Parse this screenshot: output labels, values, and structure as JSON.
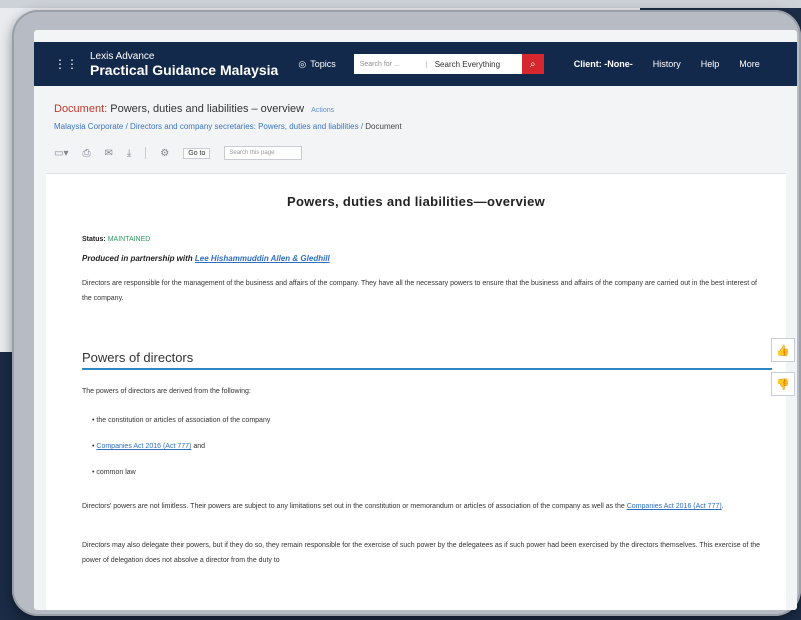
{
  "header": {
    "logo_top": "Lexis Advance",
    "logo_main": "Practical Guidance Malaysia",
    "topics": "Topics",
    "search_placeholder": "Search for ...",
    "search_scope": "Search Everything",
    "nav": [
      "Client: -None-",
      "History",
      "Help",
      "More"
    ]
  },
  "document": {
    "label": "Document:",
    "title": "Powers, duties and liabilities – overview",
    "actions": "Actions",
    "breadcrumb": [
      "Malaysia Corporate",
      "Directors and company secretaries: Powers, duties and liabilities"
    ],
    "breadcrumb_current": "Document"
  },
  "toolbar": {
    "goto": "Go to",
    "search_page": "Search this page"
  },
  "content": {
    "heading": "Powers, duties and liabilities—overview",
    "status_label": "Status:",
    "status_value": "MAINTAINED",
    "partner_prefix": "Produced in partnership with",
    "partner_name": "Lee Hishammuddin Allen & Gledhill",
    "intro": "Directors are responsible for the management of the business and affairs of the company. They have all the necessary powers to ensure that the business and affairs of the company are carried out in the best interest of the company.",
    "section_title": "Powers of directors",
    "powers_intro": "The powers of directors are derived from the following:",
    "bullets": [
      "the constitution or articles of association of the company",
      "Companies Act 2016 (Act 777)",
      "and",
      "common law"
    ],
    "para2_a": "Directors' powers are not limitless. Their powers are subject to any limitations set out in the constitution or memorandum or articles of association of the company as well as the",
    "para2_link": "Companies Act 2016 (Act 777)",
    "para3": "Directors may also delegate their powers, but if they do so, they remain responsible for the exercise of such power by the delegatees as if such power had been exercised by the directors themselves. This exercise of the power of delegation does not absolve a director from the duty to"
  }
}
